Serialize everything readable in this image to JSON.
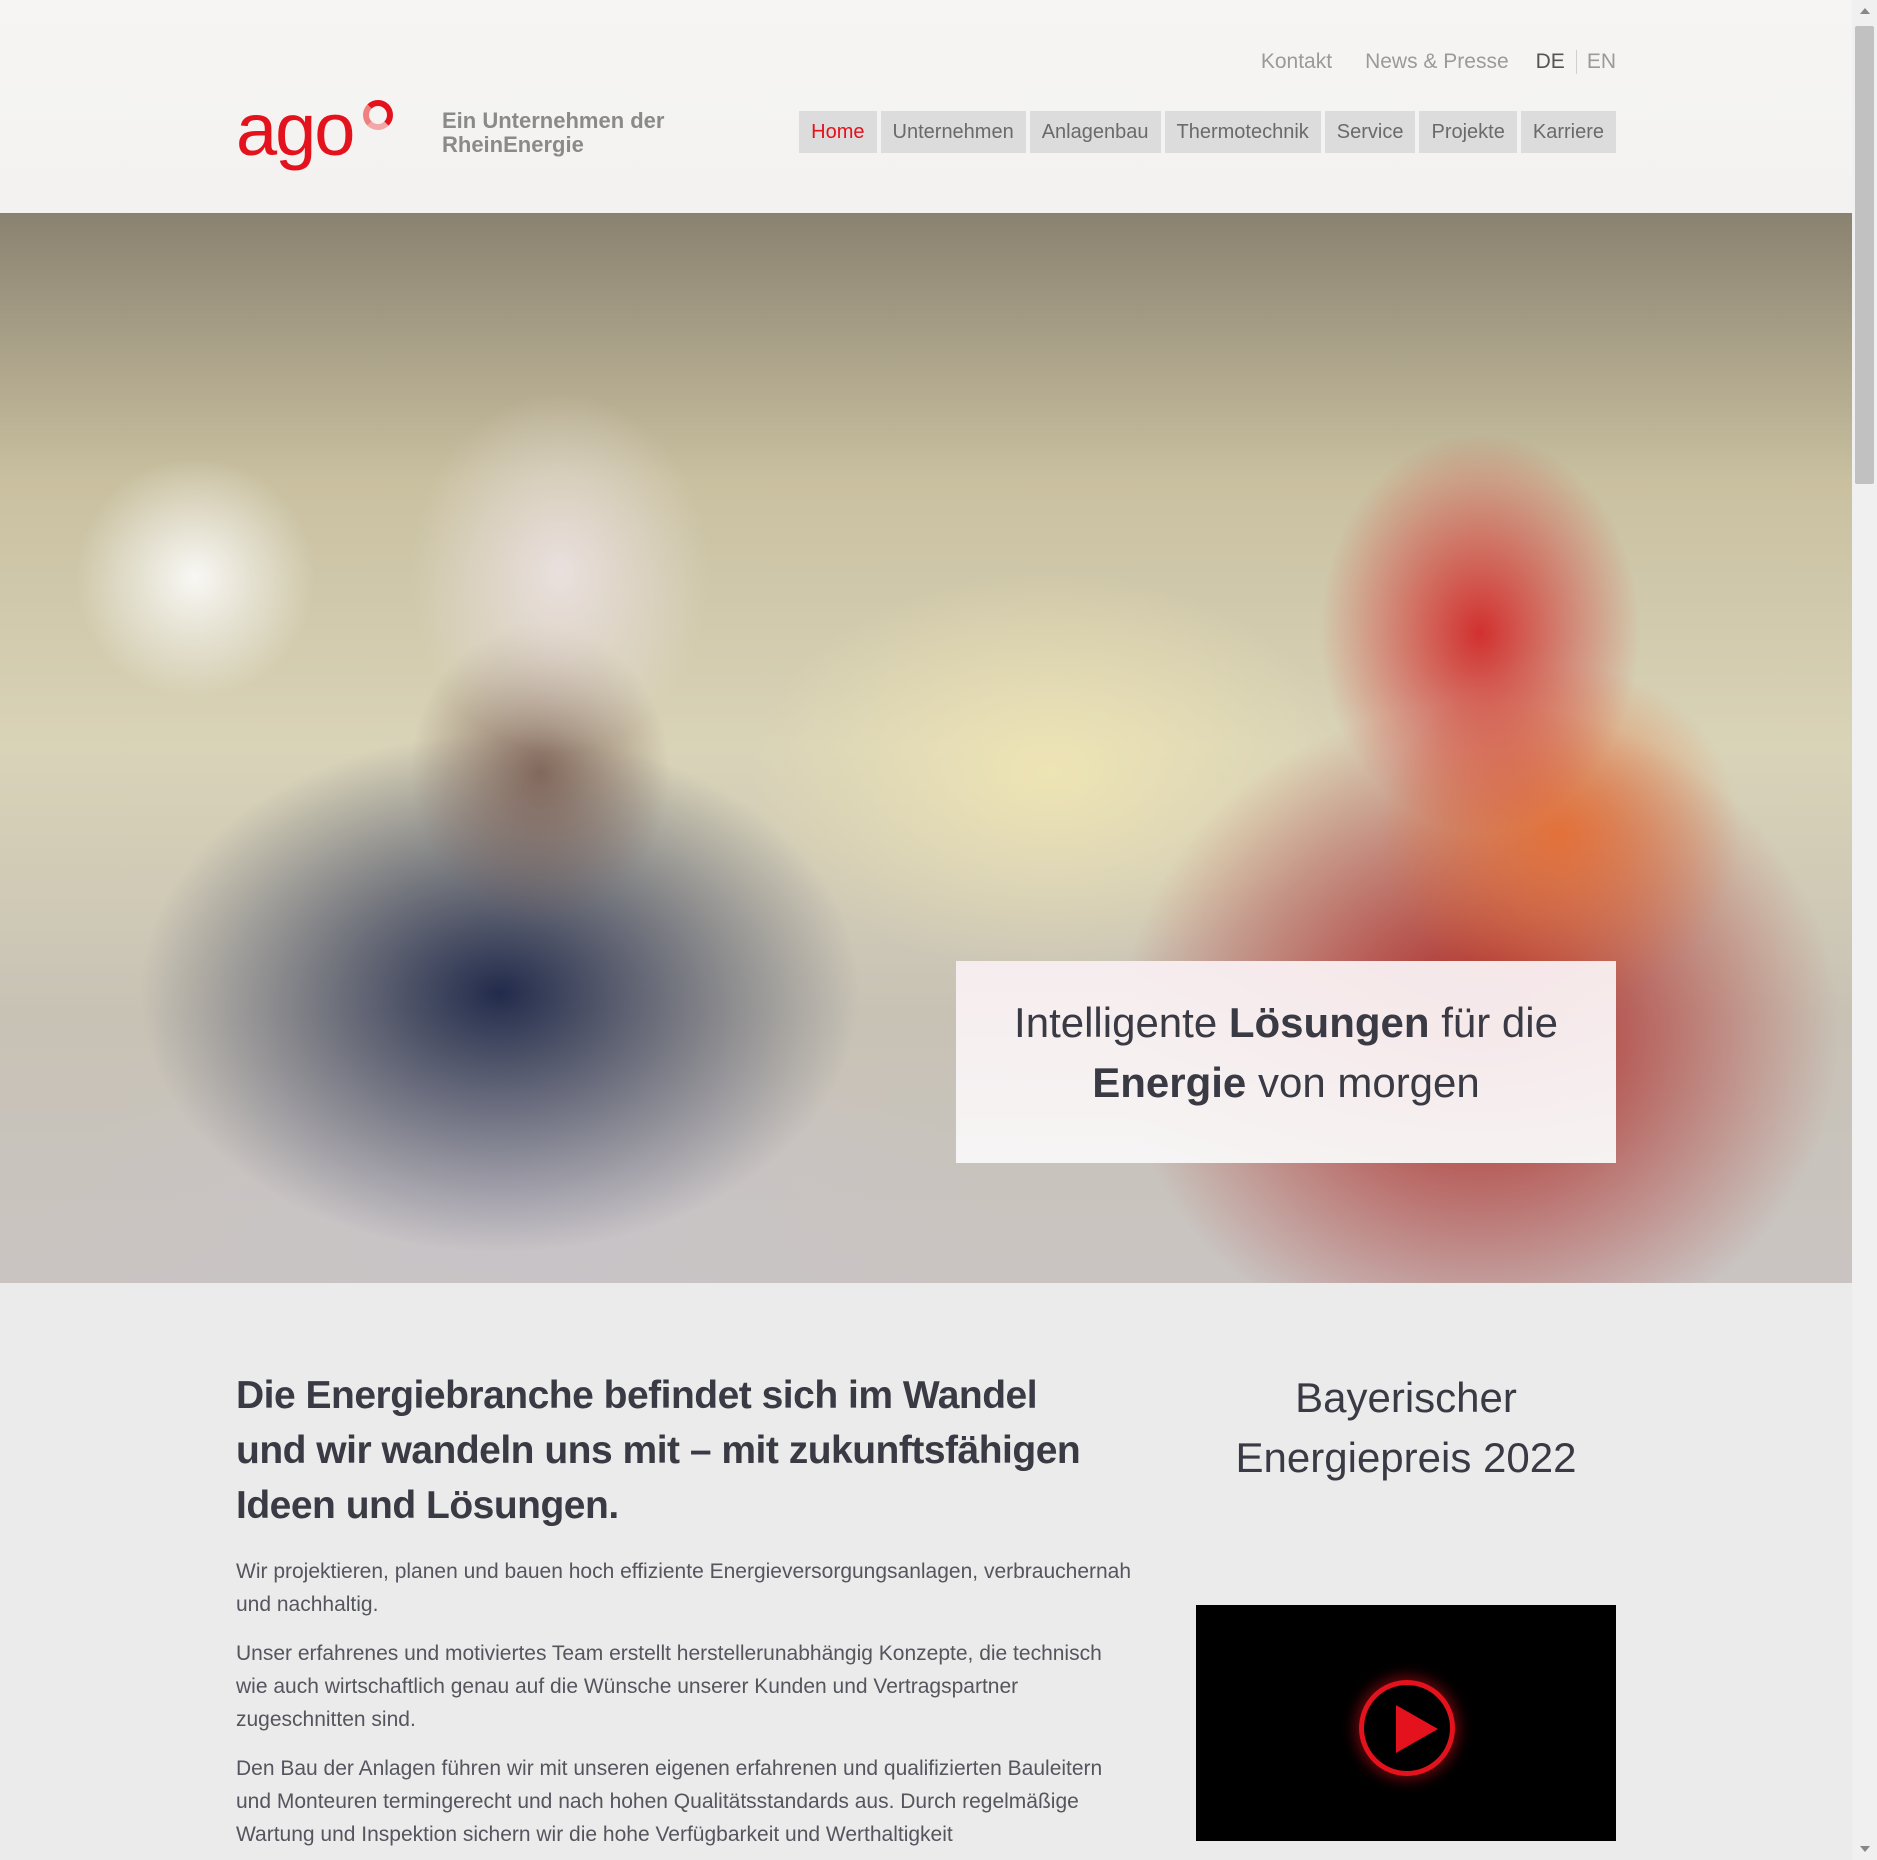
{
  "top_links": {
    "kontakt": "Kontakt",
    "news": "News & Presse",
    "lang_de": "DE",
    "lang_en": "EN"
  },
  "logo": {
    "word": "ago",
    "tagline_line1": "Ein Unternehmen der",
    "tagline_line2": "RheinEnergie"
  },
  "nav": {
    "items": [
      {
        "label": "Home",
        "active": true
      },
      {
        "label": "Unternehmen"
      },
      {
        "label": "Anlagenbau"
      },
      {
        "label": "Thermotechnik"
      },
      {
        "label": "Service"
      },
      {
        "label": "Projekte"
      },
      {
        "label": "Karriere"
      }
    ]
  },
  "hero": {
    "l1_a": "Intelligente ",
    "l1_b": "Lösungen",
    "l1_c": " für die",
    "l2_a": "Energie",
    "l2_b": " von morgen"
  },
  "content": {
    "headline_bold_1": "Die Energiebranche befindet sich im Wandel",
    "headline_bold_2": "und wir wandeln uns mit",
    "headline_rest": " – mit zukunftsfähigen Ideen und Lösungen.",
    "p1": "Wir projektieren, planen und bauen hoch effiziente Energieversorgungsanlagen, verbrauchernah und nachhaltig.",
    "p2": "Unser erfahrenes und motiviertes Team erstellt herstellerunabhängig Konzepte, die technisch wie auch wirtschaftlich genau auf die Wünsche unserer Kunden und Vertragspartner zugeschnitten sind.",
    "p3": "Den Bau der Anlagen führen wir mit unseren eigenen erfahrenen und qualifizierten Bauleitern und Monteuren termingerecht und nach hohen Qualitätsstandards aus. Durch regelmäßige Wartung und Inspektion sichern wir die hohe Verfügbarkeit und Werthaltigkeit"
  },
  "side": {
    "title_line1": "Bayerischer",
    "title_line2": "Energiepreis 2022"
  },
  "colors": {
    "brand_red": "#e3121c",
    "text_dark": "#3a3a44",
    "nav_bg": "#dcdcdc",
    "page_bg": "#ebebeb"
  },
  "icons": {
    "play": "play-icon"
  }
}
